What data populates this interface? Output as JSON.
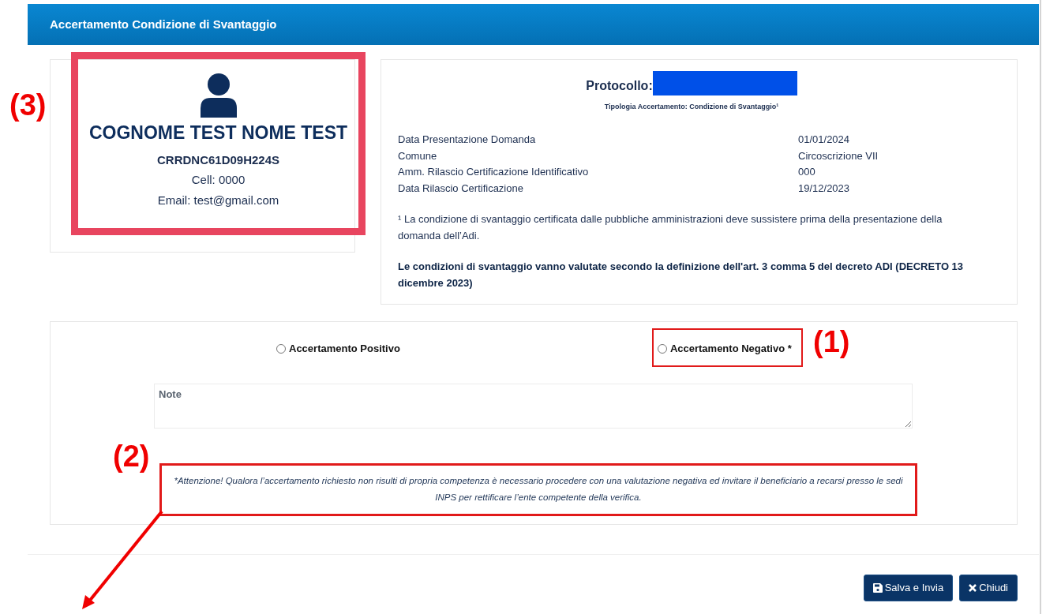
{
  "dialog": {
    "title": "Accertamento Condizione di Svantaggio"
  },
  "person": {
    "name": "COGNOME TEST NOME TEST",
    "fiscal_code": "CRRDNC61D09H224S",
    "cell": "Cell: 0000",
    "email": "Email: test@gmail.com"
  },
  "details": {
    "protocol_label": "Protocollo:",
    "type_line": "Tipologia Accertamento: Condizione di Svantaggio¹",
    "rows": [
      {
        "label": "Data Presentazione Domanda",
        "value": "01/01/2024"
      },
      {
        "label": "Comune",
        "value": "Circoscrizione VII"
      },
      {
        "label": "Amm. Rilascio Certificazione Identificativo",
        "value": "000"
      },
      {
        "label": "Data Rilascio Certificazione",
        "value": "19/12/2023"
      }
    ],
    "footnote": "¹ La condizione di svantaggio certificata dalle pubbliche amministrazioni deve sussistere prima della presentazione della domanda dell’Adi.",
    "bold_note": "Le condizioni di svantaggio vanno valutate secondo la definizione dell'art. 3 comma 5 del decreto ADI (DECRETO 13 dicembre 2023)"
  },
  "outcome": {
    "options": [
      {
        "label": "Accertamento Positivo",
        "selected": false
      },
      {
        "label": "Accertamento Negativo *",
        "selected": false
      }
    ]
  },
  "notes": {
    "placeholder": "Note"
  },
  "warning": "*Attenzione! Qualora l’accertamento richiesto non risulti di propria competenza è necessario procedere con una valutazione negativa ed invitare il beneficiario a recarsi presso le sedi INPS per rettificare l’ente competente della verifica.",
  "buttons": [
    {
      "label": "Salva e Invia",
      "kind": "save"
    },
    {
      "label": "Chiudi",
      "kind": "close"
    }
  ],
  "annotations": [
    "(1)",
    "(2)",
    "(3)"
  ]
}
